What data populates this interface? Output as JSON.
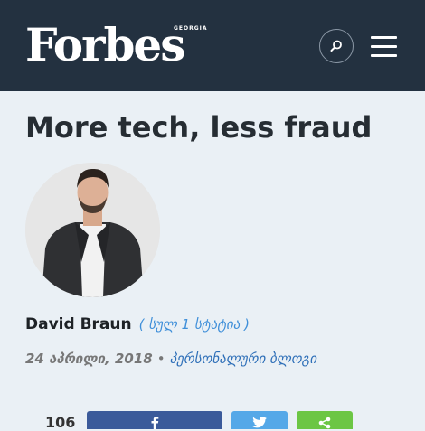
{
  "header": {
    "logo": "Forbes",
    "logo_edition": "GEORGIA",
    "search_icon": "search-icon",
    "menu_icon": "hamburger-menu-icon"
  },
  "article": {
    "title": "More tech, less fraud",
    "author": {
      "name": "David Braun",
      "articles_label": "( სულ 1 სტატია )"
    },
    "date": "24 აპრილი, 2018",
    "separator": "•",
    "category": "პერსონალური ბლოგი"
  },
  "share": {
    "count": "106",
    "buttons": [
      "facebook",
      "twitter",
      "share"
    ]
  },
  "colors": {
    "header_bg": "#233140",
    "page_bg": "#eaf0f5",
    "link": "#3f8fd9",
    "facebook": "#3b5a9a",
    "twitter": "#55a8e8",
    "share": "#6cc644"
  }
}
